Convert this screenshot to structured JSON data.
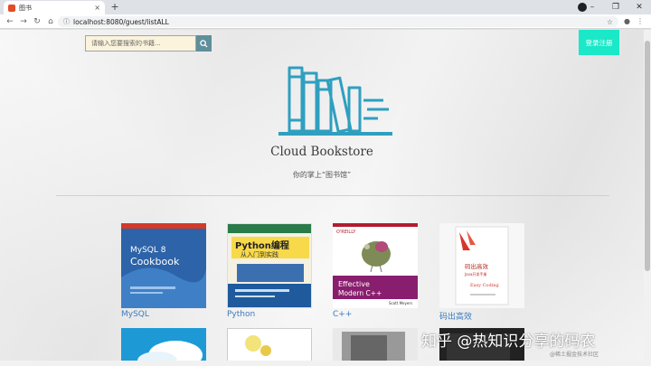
{
  "browser": {
    "tab_title": "图书",
    "tab_close": "×",
    "new_tab": "+",
    "url": "localhost:8080/guest/listALL",
    "minimize": "–",
    "restore": "❐",
    "close": "✕"
  },
  "header": {
    "search_placeholder": "请输入您要搜索的书籍...",
    "login_label": "登录注册"
  },
  "hero": {
    "title": "Cloud Bookstore",
    "subtitle": "你的掌上“图书馆”"
  },
  "books": [
    {
      "label": "MySQL",
      "cover_top": "MySQL 8",
      "cover_main": "Cookbook"
    },
    {
      "label": "Python",
      "cover_top": "Python编程",
      "cover_main": "从入门到实践"
    },
    {
      "label": "C++",
      "cover_top": "O'REILLY",
      "cover_main": "Effective Modern C++"
    },
    {
      "label": "码出高效",
      "cover_top": "码出高效",
      "cover_main": "Java开发手册"
    }
  ],
  "watermark": {
    "text": "知乎 @热知识分享的码农",
    "small": "@稀土掘金技术社区"
  },
  "colors": {
    "accent": "#1ae8c8",
    "search_button": "#5e8f9a",
    "logo": "#2f9fbf",
    "link": "#3b7bbf"
  }
}
